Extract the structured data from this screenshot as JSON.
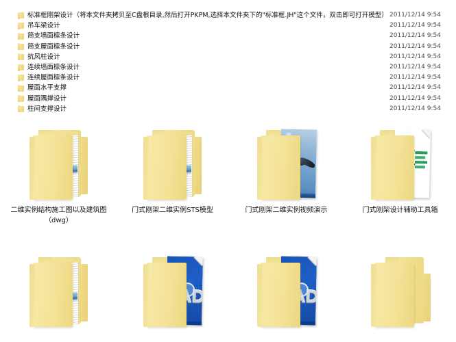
{
  "file_list": {
    "rows": [
      {
        "name": "标准框刚架设计（将本文件夹拷贝至C盘根目录,然后打开PKPM,选择本文件夹下的\"标准框.JH\"这个文件，双击即可打开模型）",
        "date": "2011/12/14 9:54",
        "icon": "folder-icon"
      },
      {
        "name": "吊车梁设计",
        "date": "2011/12/14 9:54",
        "icon": "folder-icon"
      },
      {
        "name": "简支墙面檩条设计",
        "date": "2011/12/14 9:54",
        "icon": "folder-icon"
      },
      {
        "name": "简支屋面檩条设计",
        "date": "2011/12/14 9:54",
        "icon": "folder-icon"
      },
      {
        "name": "抗风柱设计",
        "date": "2011/12/14 9:54",
        "icon": "folder-icon"
      },
      {
        "name": "连续墙面檩条设计",
        "date": "2011/12/14 9:54",
        "icon": "folder-icon"
      },
      {
        "name": "连续屋面檩条设计",
        "date": "2011/12/14 9:54",
        "icon": "folder-icon"
      },
      {
        "name": "屋面水平支撑",
        "date": "2011/12/14 9:54",
        "icon": "folder-icon"
      },
      {
        "name": "屋面隅撑设计",
        "date": "2011/12/14 9:54",
        "icon": "folder-icon"
      },
      {
        "name": "柱间支撑设计",
        "date": "2011/12/14 9:54",
        "icon": "folder-icon"
      }
    ]
  },
  "icon_grid": {
    "row1": [
      {
        "label": "二维实例结构施工图以及建筑图（dwg）",
        "icon": "folder-with-documents-icon"
      },
      {
        "label": "门式刚架二维实例STS模型",
        "icon": "folder-with-documents-icon"
      },
      {
        "label": "门式刚架二维实例视频演示",
        "icon": "folder-with-video-thumbnail-icon"
      },
      {
        "label": "门式刚架设计辅助工具箱",
        "icon": "folder-with-excel-document-icon"
      }
    ],
    "row2": [
      {
        "label": "",
        "icon": "folder-with-documents-icon"
      },
      {
        "label": "",
        "icon": "folder-with-cad-document-icon"
      },
      {
        "label": "",
        "icon": "folder-with-cad-document-icon"
      },
      {
        "label": "",
        "icon": "empty-folder-icon"
      }
    ]
  },
  "colors": {
    "folder_yellow": "#f3e195",
    "folder_yellow_dark": "#ecd881",
    "excel_green": "#1d7040",
    "cad_blue": "#1e5ec6",
    "sky_blue": "#6f9fcb",
    "background": "#ffffff",
    "text": "#121212",
    "date_text": "#4a4a4a"
  }
}
